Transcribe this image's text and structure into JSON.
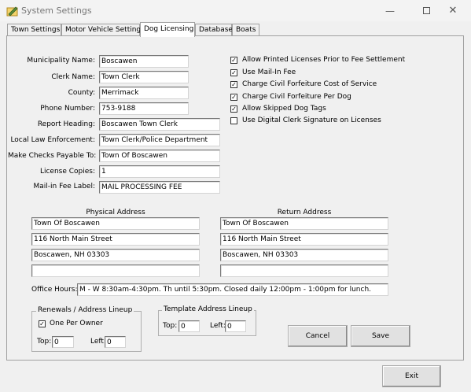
{
  "window": {
    "title": "System Settings"
  },
  "tabs": [
    {
      "label": "Town Settings"
    },
    {
      "label": "Motor Vehicle Settings"
    },
    {
      "label": "Dog Licensing"
    },
    {
      "label": "Database"
    },
    {
      "label": "Boats"
    }
  ],
  "form": {
    "municipality_name": {
      "label": "Municipality Name:",
      "value": "Boscawen"
    },
    "clerk_name": {
      "label": "Clerk Name:",
      "value": "Town Clerk"
    },
    "county": {
      "label": "County:",
      "value": "Merrimack"
    },
    "phone_number": {
      "label": "Phone Number:",
      "value": "753-9188"
    },
    "report_heading": {
      "label": "Report Heading:",
      "value": "Boscawen Town Clerk"
    },
    "local_law": {
      "label": "Local Law Enforcement:",
      "value": "Town Clerk/Police Department"
    },
    "checks_payable": {
      "label": "Make Checks Payable To:",
      "value": "Town Of Boscawen"
    },
    "license_copies": {
      "label": "License Copies:",
      "value": "1"
    },
    "mailin_fee_label": {
      "label": "Mail-in Fee Label:",
      "value": "MAIL PROCESSING FEE"
    }
  },
  "options": [
    {
      "label": "Allow Printed Licenses Prior to Fee Settlement",
      "checked": true
    },
    {
      "label": "Use Mail-In Fee",
      "checked": true
    },
    {
      "label": "Charge Civil Forfeiture Cost of Service",
      "checked": true
    },
    {
      "label": "Charge Civil Forfeiture Per Dog",
      "checked": true
    },
    {
      "label": "Allow Skipped Dog Tags",
      "checked": true
    },
    {
      "label": "Use Digital Clerk Signature on Licenses",
      "checked": false
    }
  ],
  "physical_address": {
    "heading": "Physical Address",
    "lines": [
      "Town Of Boscawen",
      "116 North Main Street",
      "Boscawen, NH 03303",
      ""
    ]
  },
  "return_address": {
    "heading": "Return Address",
    "lines": [
      "Town Of Boscawen",
      "116 North Main Street",
      "Boscawen, NH 03303",
      ""
    ]
  },
  "office_hours": {
    "label": "Office Hours:",
    "value": "M - W 8:30am-4:30pm. Th until 5:30pm. Closed daily 12:00pm - 1:00pm for lunch."
  },
  "renewals": {
    "legend": "Renewals / Address Lineup",
    "one_per_owner": {
      "label": "One Per Owner",
      "checked": true
    },
    "top_label": "Top:",
    "top_value": "0",
    "left_label": "Left:",
    "left_value": "0"
  },
  "template_lineup": {
    "legend": "Template Address Lineup",
    "top_label": "Top:",
    "top_value": "0",
    "left_label": "Left:",
    "left_value": "0"
  },
  "buttons": {
    "cancel": "Cancel",
    "save": "Save",
    "exit": "Exit"
  }
}
